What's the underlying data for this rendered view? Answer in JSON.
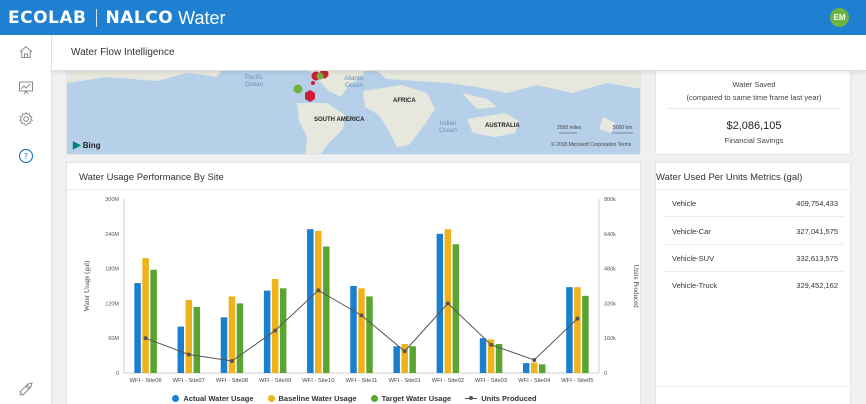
{
  "header": {
    "brand_ecolab": "ECOLAB",
    "brand_nalco": "NALCO",
    "brand_water": "Water",
    "user_initials": "EM",
    "color": "#1f7fd0"
  },
  "page": {
    "title": "Water Flow Intelligence"
  },
  "sidebar": {
    "items": [
      {
        "icon": "home-icon"
      },
      {
        "icon": "monitor-chart-icon"
      },
      {
        "icon": "gear-icon"
      },
      {
        "icon": "help-icon"
      },
      {
        "icon": "rocket-icon"
      }
    ]
  },
  "map": {
    "labels": {
      "pacific": "Pacific\nOcean",
      "atlantic": "Atlantic\nOcean",
      "africa": "AFRICA",
      "south_america": "SOUTH AMERICA",
      "indian": "Indian\nOcean",
      "australia": "AUSTRALIA"
    },
    "bing": "Bing",
    "scale_miles": "2500 miles",
    "scale_km": "5000 km",
    "copyright": "© 2018 Microsoft Corporation Terms"
  },
  "savings": {
    "line1": "Water Saved",
    "line2": "(compared to same time frame last year)",
    "amount": "$2,086,105",
    "caption": "Financial Savings"
  },
  "chart_data": {
    "type": "bar",
    "title": "Water Usage Performance By Site",
    "ylabel": "Water Usage (gal)",
    "y2label": "Units Produced",
    "ylim": [
      0,
      300000000
    ],
    "y2lim": [
      0,
      800000
    ],
    "y_ticks": [
      "0",
      "60M",
      "120M",
      "180M",
      "240M",
      "300M"
    ],
    "y2_ticks": [
      "0",
      "160k",
      "320k",
      "480k",
      "640k",
      "800k"
    ],
    "categories": [
      "WFI - Site06",
      "WFI - Site07",
      "WFI - Site08",
      "WFI - Site09",
      "WFI - Site10",
      "WFI - Site11",
      "WFI - Site01",
      "WFI - Site02",
      "WFI - Site03",
      "WFI - Site04",
      "WFI - Site05"
    ],
    "series": [
      {
        "name": "Actual Water Usage",
        "color": "#1a7fcd",
        "values": [
          155000000,
          80000000,
          96000000,
          142000000,
          248000000,
          150000000,
          46000000,
          240000000,
          60000000,
          17000000,
          148000000
        ]
      },
      {
        "name": "Baseline Water Usage",
        "color": "#f0b21b",
        "values": [
          198000000,
          126000000,
          132000000,
          162000000,
          245000000,
          146000000,
          50000000,
          248000000,
          58000000,
          18000000,
          148000000
        ]
      },
      {
        "name": "Target Water Usage",
        "color": "#5aa532",
        "values": [
          178000000,
          114000000,
          120000000,
          146000000,
          218000000,
          132000000,
          46000000,
          222000000,
          50000000,
          15000000,
          133000000
        ]
      }
    ],
    "line_series": {
      "name": "Units Produced",
      "color": "#555555",
      "axis": "y2",
      "values": [
        160000,
        85000,
        55000,
        195000,
        380000,
        265000,
        100000,
        320000,
        130000,
        60000,
        250000
      ]
    },
    "grid": false,
    "legend_position": "bottom"
  },
  "metrics": {
    "title": "Water Used Per Units Metrics (gal)",
    "rows": [
      {
        "label": "Vehicle",
        "value": "409,754,433"
      },
      {
        "label": "Vehicle-Car",
        "value": "327,041,575"
      },
      {
        "label": "Vehicle-SUV",
        "value": "332,613,575"
      },
      {
        "label": "Vehicle-Truck",
        "value": "329,452,162"
      }
    ]
  }
}
